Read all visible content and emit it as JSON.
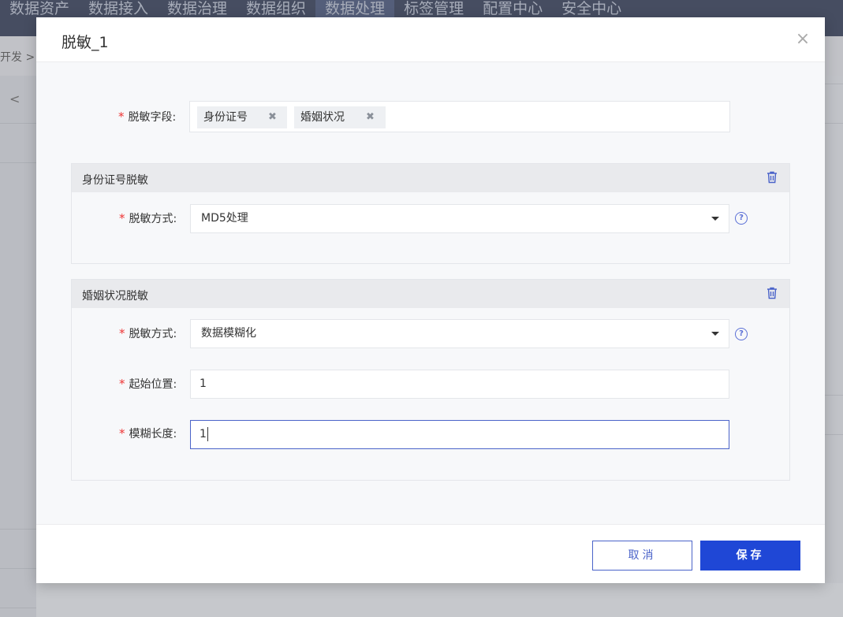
{
  "topnav": {
    "items": [
      "数据资产",
      "数据接入",
      "数据治理",
      "数据组织",
      "数据处理",
      "标签管理",
      "配置中心",
      "安全中心"
    ]
  },
  "breadcrumb": "开发 >",
  "back_glyph": "<",
  "modal": {
    "title": "脱敏_1",
    "close_glyph": "×",
    "fields_label": "脱敏字段:",
    "tags": [
      {
        "label": "身份证号",
        "remove": "✖"
      },
      {
        "label": "婚姻状况",
        "remove": "✖"
      }
    ],
    "panels": [
      {
        "title": "身份证号脱敏",
        "method_label": "脱敏方式:",
        "method_value": "MD5处理"
      },
      {
        "title": "婚姻状况脱敏",
        "method_label": "脱敏方式:",
        "method_value": "数据模糊化",
        "start_label": "起始位置:",
        "start_value": "1",
        "length_label": "模糊长度:",
        "length_value": "1"
      }
    ],
    "help_glyph": "?",
    "cancel_label": "取消",
    "save_label": "保存"
  },
  "colors": {
    "primary": "#1f47d6",
    "required": "#e33333",
    "help": "#5a6fd6"
  }
}
